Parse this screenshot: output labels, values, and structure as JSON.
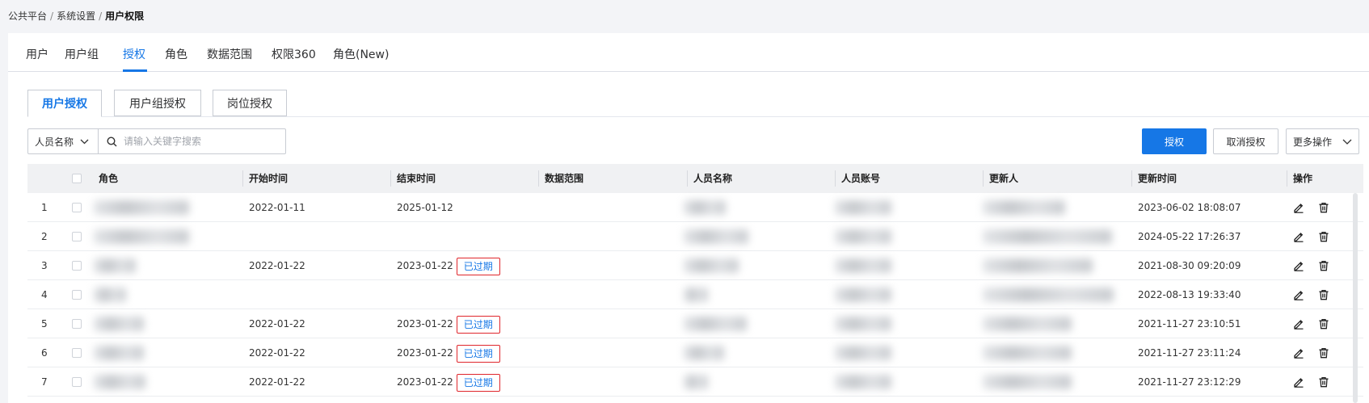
{
  "breadcrumb": {
    "item1": "公共平台",
    "item2": "系统设置",
    "current": "用户权限",
    "sep": "/"
  },
  "main_tabs": [
    {
      "label": "用户"
    },
    {
      "label": "用户组"
    },
    {
      "label": "授权",
      "active": true
    },
    {
      "label": "角色"
    },
    {
      "label": "数据范围"
    },
    {
      "label": "权限360"
    },
    {
      "label": "角色(New)"
    }
  ],
  "sub_tabs": [
    {
      "label": "用户授权",
      "active": true
    },
    {
      "label": "用户组授权"
    },
    {
      "label": "岗位授权"
    }
  ],
  "search": {
    "field_label": "人员名称",
    "placeholder": "请输入关键字搜索"
  },
  "toolbar": {
    "grant_label": "授权",
    "revoke_label": "取消授权",
    "more_label": "更多操作"
  },
  "table": {
    "headers": {
      "role": "角色",
      "start": "开始时间",
      "end": "结束时间",
      "scope": "数据范围",
      "name": "人员名称",
      "account": "人员账号",
      "updater": "更新人",
      "updated": "更新时间",
      "ops": "操作"
    },
    "expired_label": "已过期",
    "rows": [
      {
        "index": "1",
        "start": "2022-01-11",
        "end": "2025-01-12",
        "expired": false,
        "updated": "2023-06-02 18:08:07"
      },
      {
        "index": "2",
        "start": "",
        "end": "",
        "expired": false,
        "updated": "2024-05-22 17:26:37"
      },
      {
        "index": "3",
        "start": "2022-01-22",
        "end": "2023-01-22",
        "expired": true,
        "updated": "2021-08-30 09:20:09"
      },
      {
        "index": "4",
        "start": "",
        "end": "",
        "expired": false,
        "updated": "2022-08-13 19:33:40"
      },
      {
        "index": "5",
        "start": "2022-01-22",
        "end": "2023-01-22",
        "expired": true,
        "updated": "2021-11-27 23:10:51"
      },
      {
        "index": "6",
        "start": "2022-01-22",
        "end": "2023-01-22",
        "expired": true,
        "updated": "2021-11-27 23:11:24"
      },
      {
        "index": "7",
        "start": "2022-01-22",
        "end": "2023-01-22",
        "expired": true,
        "updated": "2021-11-27 23:12:29"
      }
    ]
  },
  "colors": {
    "accent": "#1677e6",
    "expired_border": "#e0262c"
  }
}
